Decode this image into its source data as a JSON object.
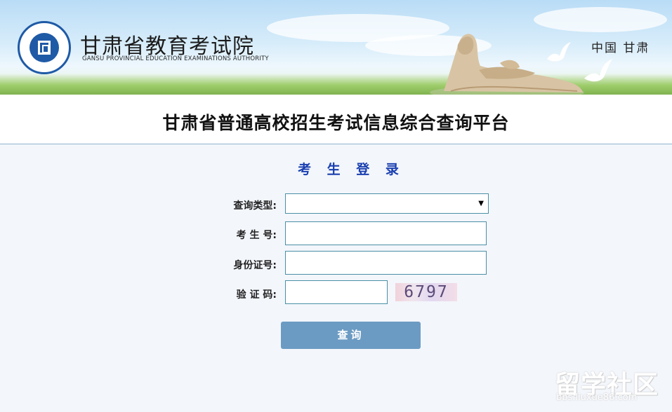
{
  "header": {
    "org_name_cn": "甘肃省教育考试院",
    "org_name_en": "GANSU PROVINCIAL EDUCATION EXAMINATIONS AUTHORITY",
    "region": "中国 甘肃",
    "brand_color": "#1f5aa6"
  },
  "platform": {
    "title": "甘肃省普通高校招生考试信息综合查询平台"
  },
  "login": {
    "heading": "考 生 登 录",
    "query_type_label": "查询类型:",
    "query_type_value": "",
    "exam_number_label": "考 生 号:",
    "exam_number_value": "",
    "id_number_label": "身份证号:",
    "id_number_value": "",
    "captcha_label": "验 证 码:",
    "captcha_value": "",
    "captcha_image_text": "6797",
    "submit_label": "查询",
    "heading_color": "#1a3fb0",
    "button_color": "#6b9bc3"
  },
  "watermark": {
    "main": "留学社区",
    "url": "bbs.liuxue86.com"
  }
}
